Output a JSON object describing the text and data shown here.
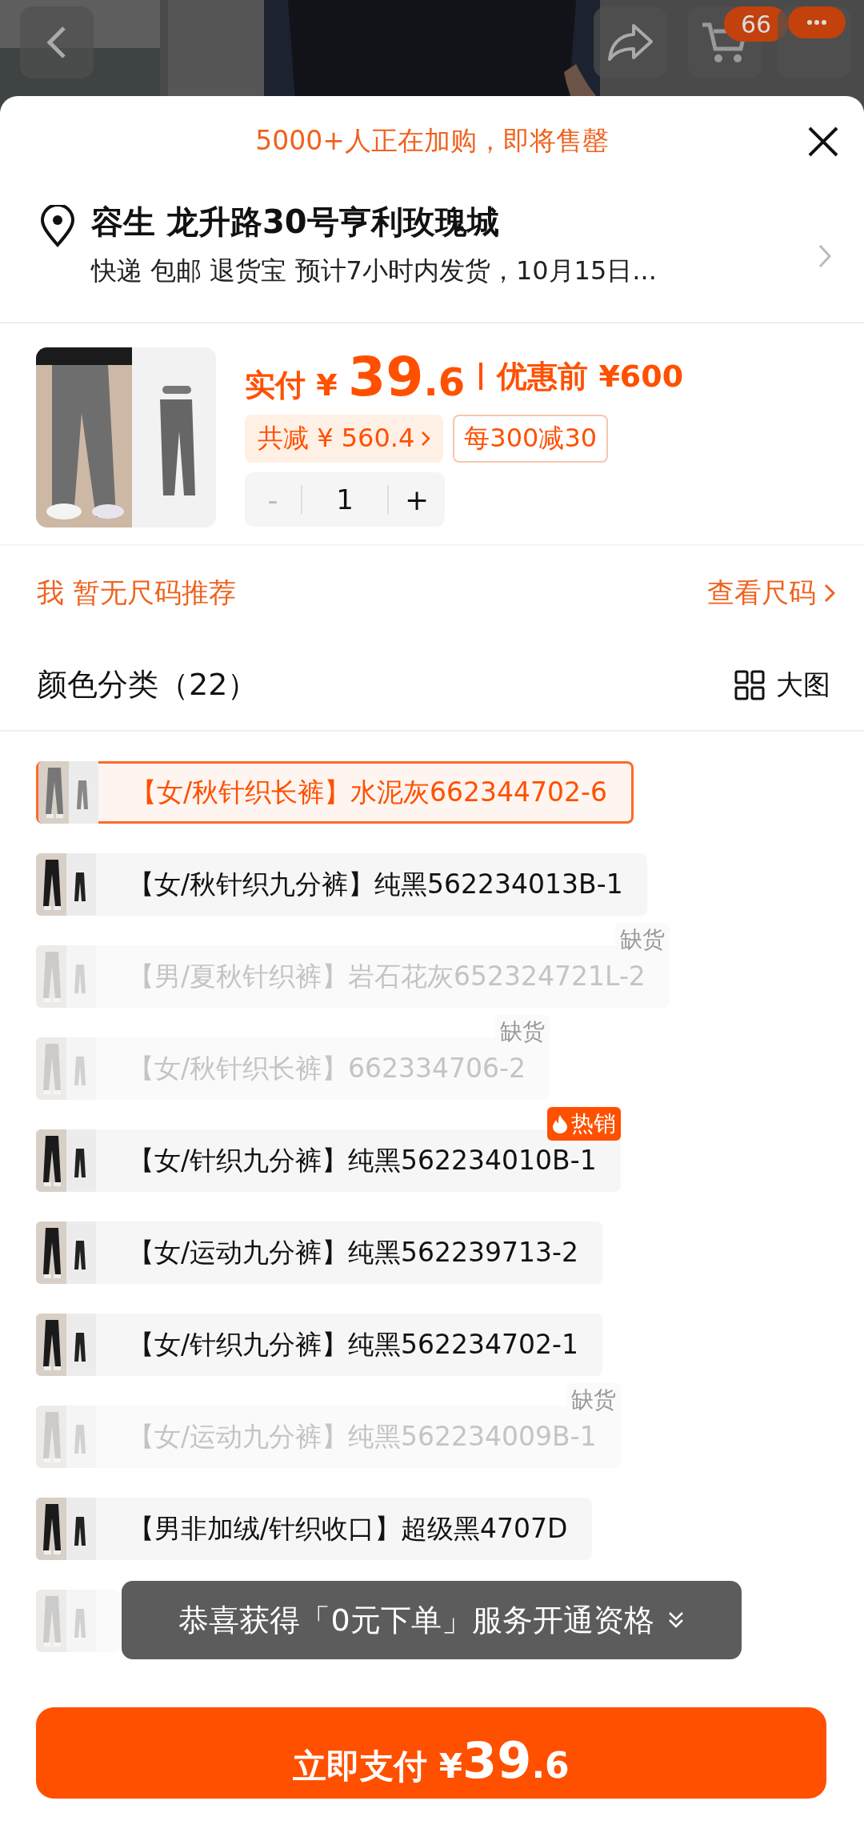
{
  "header": {
    "cart_count": "66"
  },
  "banner": {
    "text": "5000+人正在加购，即将售罄"
  },
  "address": {
    "title": "容生 龙升路30号亨利玫瑰城",
    "detail": "快递 包邮 退货宝 预计7小时内发货，10月15日..."
  },
  "product": {
    "price_label": "实付",
    "currency": "¥",
    "amount": "39.6",
    "original_price": "优惠前 ¥600",
    "discount": "共减 ¥ 560.4",
    "promo": "每300减30",
    "decrement": "-",
    "quantity": "1",
    "increment": "+"
  },
  "size": {
    "tip": "我 暂无尺码推荐",
    "link": "查看尺码"
  },
  "variants": {
    "title": "颜色分类（22）",
    "view_toggle": "大图",
    "items": [
      {
        "label": "【女/秋针织长裤】水泥灰662344702-6",
        "selected": true,
        "sold_out": false
      },
      {
        "label": "【女/秋针织九分裤】纯黑562234013B-1",
        "selected": false,
        "sold_out": false
      },
      {
        "label": "【男/夏秋针织裤】岩石花灰652324721L-2",
        "selected": false,
        "sold_out": true,
        "badge": {
          "kind": "plain",
          "text": "缺货"
        }
      },
      {
        "label": "【女/秋针织长裤】662334706-2",
        "selected": false,
        "sold_out": true,
        "badge": {
          "kind": "plain",
          "text": "缺货"
        }
      },
      {
        "label": "【女/针织九分裤】纯黑562234010B-1",
        "selected": false,
        "sold_out": false,
        "badge": {
          "kind": "hot",
          "text": "热销"
        }
      },
      {
        "label": "【女/运动九分裤】纯黑562239713-2",
        "selected": false,
        "sold_out": false
      },
      {
        "label": "【女/针织九分裤】纯黑562234702-1",
        "selected": false,
        "sold_out": false
      },
      {
        "label": "【女/运动九分裤】纯黑562234009B-1",
        "selected": false,
        "sold_out": true,
        "badge": {
          "kind": "plain",
          "text": "缺货"
        }
      },
      {
        "label": "【男非加绒/针织收口】超级黑4707D",
        "selected": false,
        "sold_out": false
      },
      {
        "selected": false,
        "sold_out": true
      }
    ]
  },
  "toast": {
    "text": "恭喜获得「0元下单」服务开通资格"
  },
  "pay_button": {
    "label": "立即支付",
    "currency": "¥",
    "amount": "39.6"
  }
}
